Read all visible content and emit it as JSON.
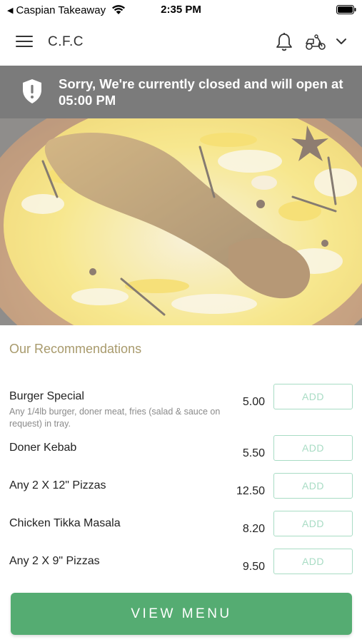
{
  "status_bar": {
    "back_label": "Caspian Takeaway",
    "time": "2:35 PM"
  },
  "header": {
    "title": "C.F.C",
    "icons": [
      "menu-icon",
      "bell-icon",
      "scooter-icon",
      "chevron-down-icon"
    ]
  },
  "banner": {
    "message": "Sorry, We're currently closed and will open at 05:00 PM",
    "icon": "shield-alert-icon",
    "background": "#7b7b7b"
  },
  "hero": {
    "icon": "food-image"
  },
  "recommendations": {
    "title": "Our Recommendations",
    "add_label": "ADD",
    "items": [
      {
        "name": "Burger Special",
        "description": "Any 1/4lb burger, doner meat, fries (salad & sauce on request) in tray.",
        "price": "5.00"
      },
      {
        "name": "Doner Kebab",
        "description": "",
        "price": "5.50"
      },
      {
        "name": "Any 2 X 12\" Pizzas",
        "description": "",
        "price": "12.50"
      },
      {
        "name": "Chicken Tikka Masala",
        "description": "",
        "price": "8.20"
      },
      {
        "name": "Any 2 X 9\" Pizzas",
        "description": "",
        "price": "9.50"
      }
    ]
  },
  "footer": {
    "view_menu_label": "VIEW MENU"
  },
  "colors": {
    "accent_green": "#55ac72",
    "add_border": "#a8dcc4",
    "section_title": "#a89a6c"
  }
}
